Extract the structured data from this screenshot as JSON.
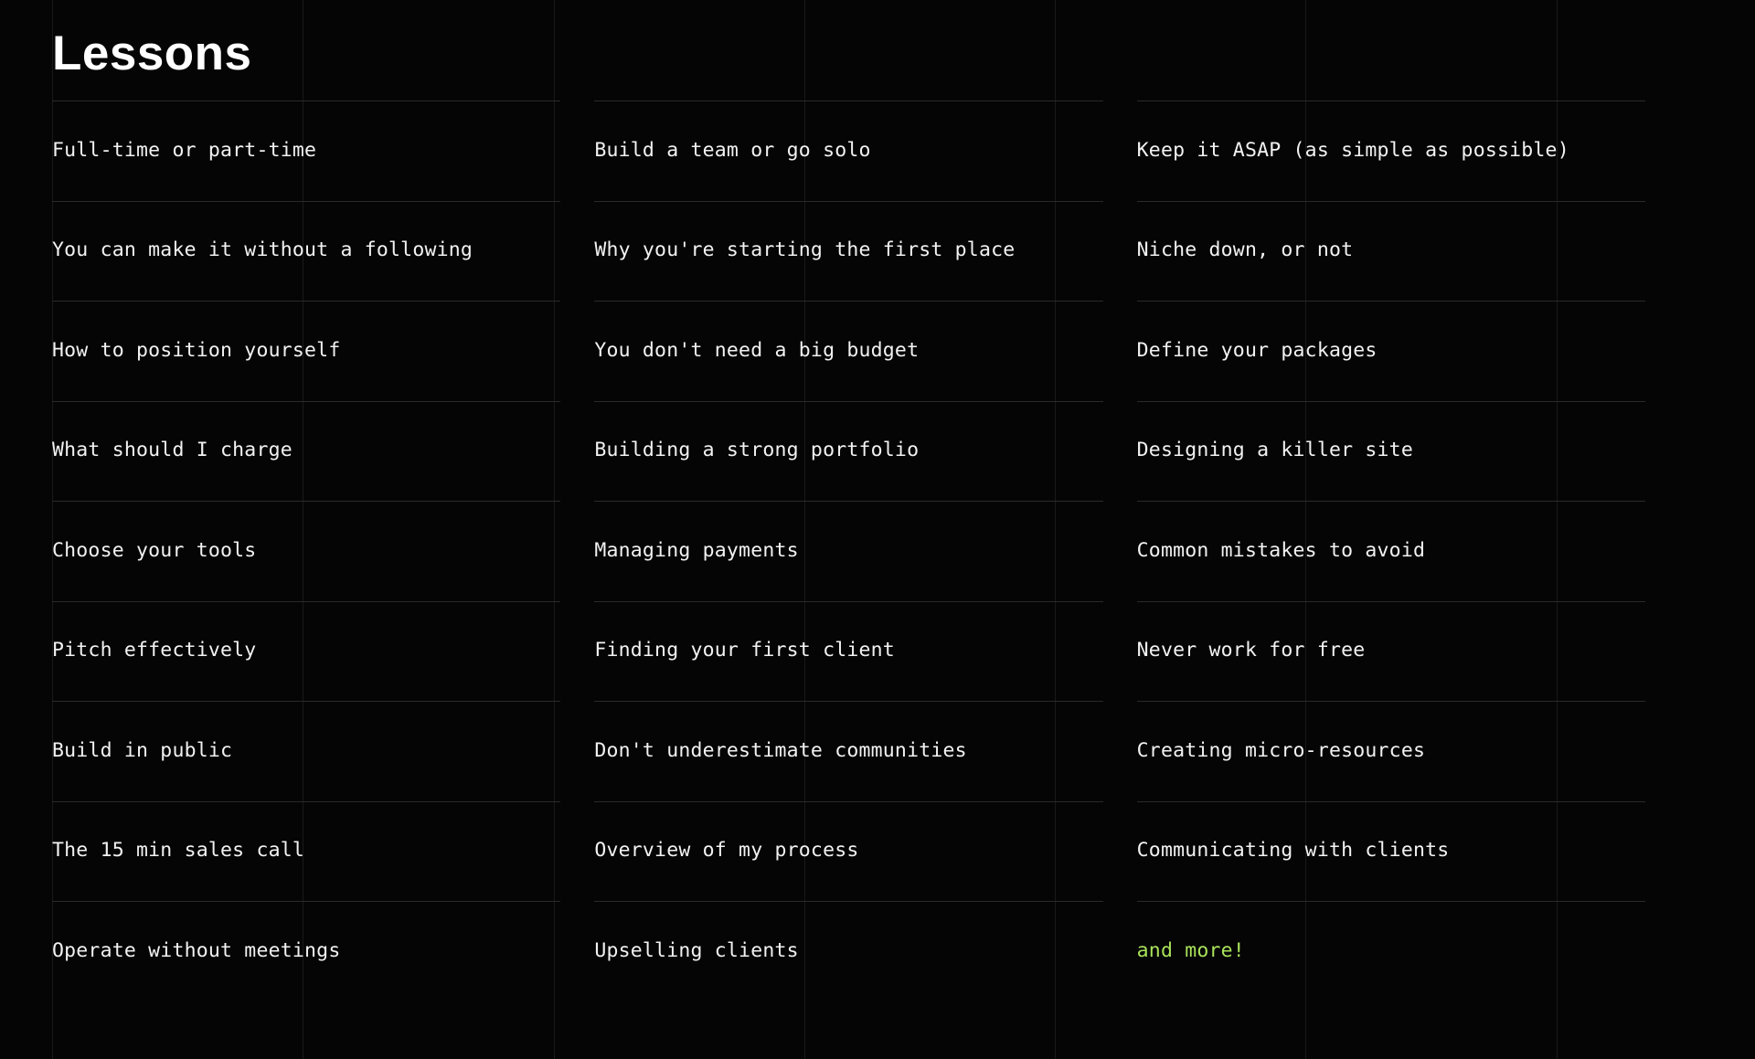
{
  "page": {
    "title": "Lessons",
    "background_color": "#050505",
    "text_color": "#f2f2f2",
    "rule_color": "#2a2a2a",
    "grid_line_color": "#191919",
    "accent_color": "#a9e25a"
  },
  "columns": [
    {
      "name": "column-1",
      "items": [
        {
          "label": "Full-time or part-time",
          "accent": false
        },
        {
          "label": "You can make it without a following",
          "accent": false
        },
        {
          "label": "How to position yourself",
          "accent": false
        },
        {
          "label": "What should I charge",
          "accent": false
        },
        {
          "label": "Choose your tools",
          "accent": false
        },
        {
          "label": "Pitch effectively",
          "accent": false
        },
        {
          "label": "Build in public",
          "accent": false
        },
        {
          "label": "The 15 min sales call",
          "accent": false
        },
        {
          "label": "Operate without meetings",
          "accent": false
        }
      ]
    },
    {
      "name": "column-2",
      "items": [
        {
          "label": "Build a team or go solo",
          "accent": false
        },
        {
          "label": "Why you're starting the first place",
          "accent": false
        },
        {
          "label": "You don't need a big budget",
          "accent": false
        },
        {
          "label": "Building a strong portfolio",
          "accent": false
        },
        {
          "label": "Managing payments",
          "accent": false
        },
        {
          "label": "Finding your first client",
          "accent": false
        },
        {
          "label": "Don't underestimate communities",
          "accent": false
        },
        {
          "label": "Overview of my process",
          "accent": false
        },
        {
          "label": "Upselling clients",
          "accent": false
        }
      ]
    },
    {
      "name": "column-3",
      "items": [
        {
          "label": "Keep it ASAP (as simple as possible)",
          "accent": false
        },
        {
          "label": "Niche down, or not",
          "accent": false
        },
        {
          "label": "Define your packages",
          "accent": false
        },
        {
          "label": "Designing a killer site",
          "accent": false
        },
        {
          "label": "Common mistakes to avoid",
          "accent": false
        },
        {
          "label": "Never work for free",
          "accent": false
        },
        {
          "label": "Creating micro-resources",
          "accent": false
        },
        {
          "label": "Communicating with clients",
          "accent": false
        },
        {
          "label": "and more!",
          "accent": true
        }
      ]
    }
  ]
}
